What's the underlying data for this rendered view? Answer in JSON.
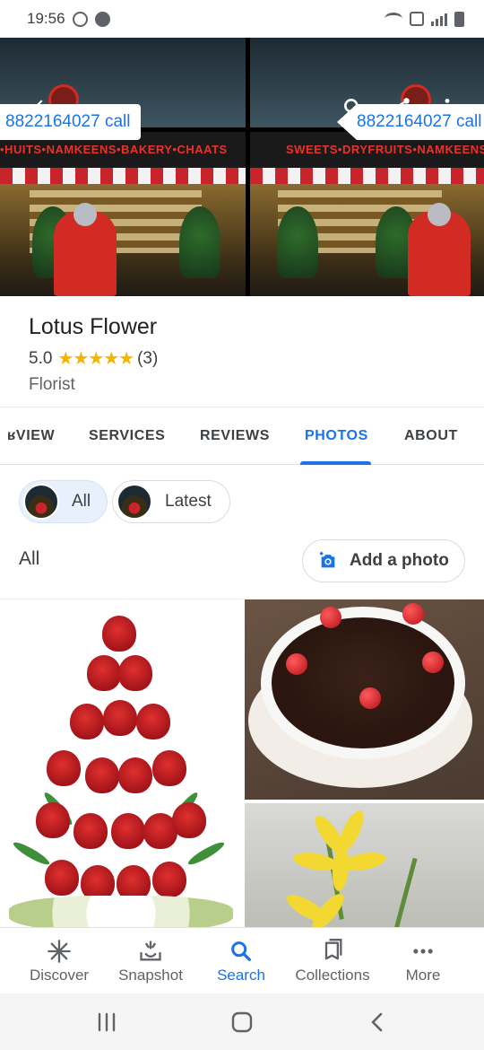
{
  "status_bar": {
    "time": "19:56"
  },
  "header": {
    "call_label_left": "8822164027 call",
    "call_label_right": "8822164027 call",
    "signboard_left": "•HUITS•NAMKEENS•BAKERY•CHAATS",
    "signboard_right": "SWEETS•DRYFRUITS•NAMKEENS•BAK"
  },
  "place": {
    "name": "Lotus Flower",
    "rating": "5.0",
    "stars": "★★★★★",
    "review_count": "(3)",
    "category": "Florist"
  },
  "tabs": [
    {
      "label": "ʁVIEW"
    },
    {
      "label": "SERVICES"
    },
    {
      "label": "REVIEWS"
    },
    {
      "label": "PHOTOS"
    },
    {
      "label": "ABOUT"
    }
  ],
  "active_tab": "PHOTOS",
  "filters": [
    {
      "label": "All",
      "selected": true
    },
    {
      "label": "Latest",
      "selected": false
    }
  ],
  "section": {
    "title": "All",
    "add_photo_label": "Add a photo"
  },
  "photos": [
    {
      "subject": "red roses arrangement"
    },
    {
      "subject": "black forest cake"
    },
    {
      "subject": "yellow lilies"
    }
  ],
  "bottom_nav": [
    {
      "label": "Discover",
      "icon": "asterisk-icon"
    },
    {
      "label": "Snapshot",
      "icon": "snapshot-icon"
    },
    {
      "label": "Search",
      "icon": "search-icon",
      "active": true
    },
    {
      "label": "Collections",
      "icon": "collections-icon"
    },
    {
      "label": "More",
      "icon": "more-horiz-icon"
    }
  ],
  "colors": {
    "accent": "#1a73e8",
    "star": "#f6b400",
    "chip_selected_bg": "#e8f0fe"
  }
}
